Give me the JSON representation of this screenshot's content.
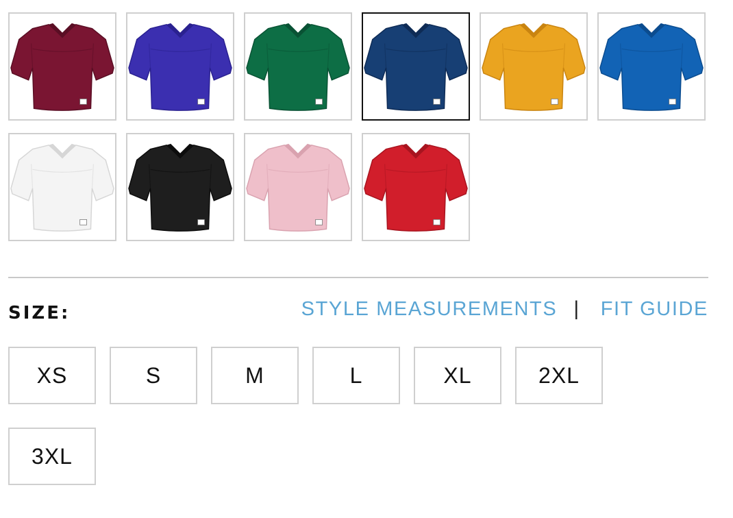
{
  "swatches": [
    {
      "name": "maroon",
      "color": "#7a1532",
      "shade": "#5a0e24",
      "selected": false
    },
    {
      "name": "purple",
      "color": "#3b2fb0",
      "shade": "#2a2190",
      "selected": false
    },
    {
      "name": "dark-green",
      "color": "#0d6e45",
      "shade": "#095234",
      "selected": false
    },
    {
      "name": "navy",
      "color": "#173f74",
      "shade": "#0e2b55",
      "selected": true
    },
    {
      "name": "gold",
      "color": "#eaa420",
      "shade": "#c98410",
      "selected": false
    },
    {
      "name": "royal",
      "color": "#1263b5",
      "shade": "#0b4c8f",
      "selected": false
    },
    {
      "name": "white",
      "color": "#f4f4f4",
      "shade": "#d6d6d6",
      "selected": false
    },
    {
      "name": "black",
      "color": "#1e1e1e",
      "shade": "#0c0c0c",
      "selected": false
    },
    {
      "name": "pink",
      "color": "#efbfca",
      "shade": "#d9a2af",
      "selected": false
    },
    {
      "name": "scarlet",
      "color": "#d11e2b",
      "shade": "#a8141f",
      "selected": false
    }
  ],
  "size_section": {
    "label": "SIZE:",
    "style_measurements_link": "STYLE MEASUREMENTS",
    "separator": "|",
    "fit_guide_link": "FIT GUIDE"
  },
  "sizes": [
    "XS",
    "S",
    "M",
    "L",
    "XL",
    "2XL",
    "3XL"
  ],
  "colors": {
    "link": "#5aa5d4",
    "border": "#cfcfcf",
    "selected_border": "#111111",
    "text": "#111111"
  }
}
